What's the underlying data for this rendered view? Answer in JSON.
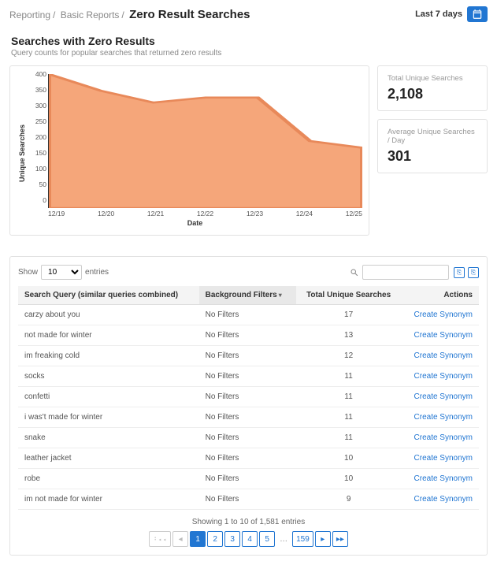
{
  "breadcrumb": {
    "a": "Reporting",
    "b": "Basic Reports",
    "current": "Zero Result Searches"
  },
  "daterange": {
    "label": "Last 7 days"
  },
  "section": {
    "title": "Searches with Zero Results",
    "subtitle": "Query counts for popular searches that returned zero results"
  },
  "stats": {
    "total_label": "Total Unique Searches",
    "total_value": "2,108",
    "avg_label": "Average Unique Searches / Day",
    "avg_value": "301"
  },
  "chart_data": {
    "type": "area",
    "categories": [
      "12/19",
      "12/20",
      "12/21",
      "12/22",
      "12/23",
      "12/24",
      "12/25"
    ],
    "values": [
      400,
      350,
      315,
      330,
      330,
      200,
      180
    ],
    "xlabel": "Date",
    "ylabel": "Unique Searches",
    "ylim": [
      0,
      400
    ],
    "yticks": [
      0,
      50,
      100,
      150,
      200,
      250,
      300,
      350,
      400
    ]
  },
  "table": {
    "show_label": "Show",
    "entries_label": "entries",
    "page_size": "10",
    "columns": {
      "query": "Search Query (similar queries combined)",
      "filters": "Background Filters",
      "total": "Total Unique Searches",
      "actions": "Actions"
    },
    "no_filters": "No Filters",
    "action_label": "Create Synonym",
    "rows": [
      {
        "q": "carzy about you",
        "t": "17"
      },
      {
        "q": "not made for winter",
        "t": "13"
      },
      {
        "q": "im freaking cold",
        "t": "12"
      },
      {
        "q": "socks",
        "t": "11"
      },
      {
        "q": "confetti",
        "t": "11"
      },
      {
        "q": "i was't made for winter",
        "t": "11"
      },
      {
        "q": "snake",
        "t": "11"
      },
      {
        "q": "leather jacket",
        "t": "10"
      },
      {
        "q": "robe",
        "t": "10"
      },
      {
        "q": "im not made for winter",
        "t": "9"
      }
    ],
    "footer": "Showing 1 to 10 of 1,581 entries",
    "pages": [
      "1",
      "2",
      "3",
      "4",
      "5"
    ],
    "last_page": "159"
  }
}
